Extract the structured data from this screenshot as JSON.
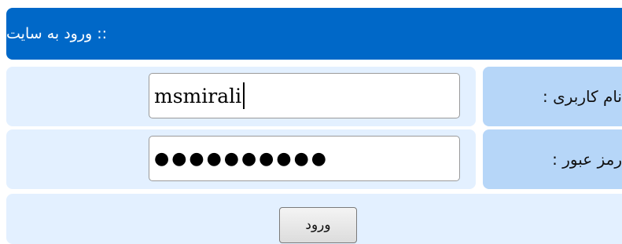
{
  "form": {
    "title": ":: ورود به سایت",
    "username_label": "نام کاربری :",
    "username_value": "msmirali",
    "password_label": "رمز عبور :",
    "password_mask": "●●●●●●●●●●",
    "submit_label": "ورود"
  },
  "colors": {
    "header_bg": "#0068c8",
    "label_bg": "#b6d6f8",
    "field_bg": "#e3f0ff"
  }
}
